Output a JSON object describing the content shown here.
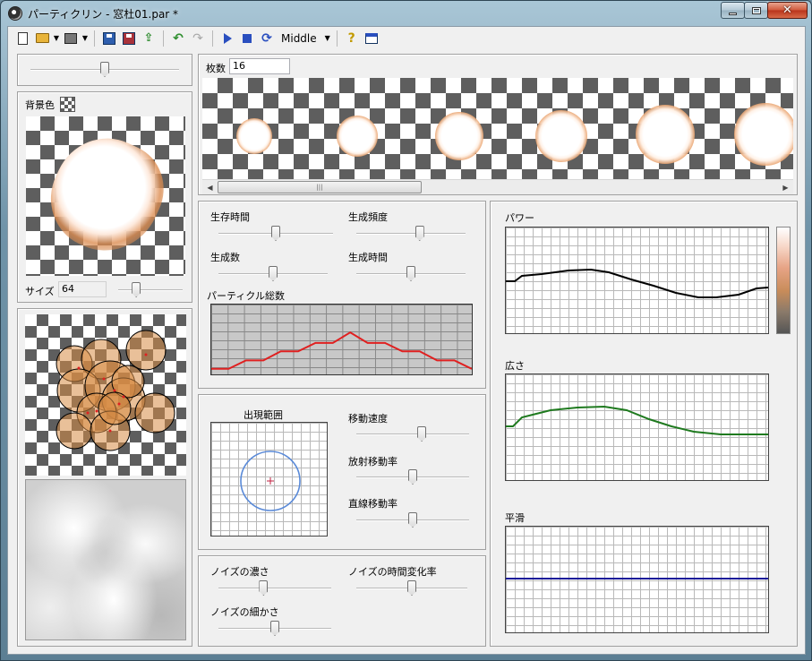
{
  "window": {
    "title": "パーティクリン - 窓杜01.par *",
    "min_label": "minimize",
    "max_label": "maximize",
    "close_label": "close"
  },
  "toolbar": {
    "speed_label": "Middle",
    "buttons": [
      "new-icon",
      "open-folder-icon",
      "export-icon",
      "save-icon",
      "save-as-icon",
      "upload-icon",
      "undo-icon",
      "redo-icon",
      "play-icon",
      "stop-icon",
      "loop-icon",
      "help-icon",
      "window-icon"
    ]
  },
  "left": {
    "top_slider_value": 0.5,
    "bg_color_label": "背景色",
    "size_label": "サイズ",
    "size_value": "64",
    "size_slider_value": 0.28
  },
  "frames": {
    "count_label": "枚数",
    "count_value": "16"
  },
  "emission": {
    "lifetime_label": "生存時間",
    "frequency_label": "生成頻度",
    "count_label": "生成数",
    "duration_label": "生成時間",
    "total_label": "パーティクル総数",
    "sliders": {
      "lifetime": 0.5,
      "frequency": 0.58,
      "count": 0.5,
      "duration": 0.5
    },
    "total_chart": [
      0.08,
      0.08,
      0.2,
      0.2,
      0.33,
      0.33,
      0.45,
      0.45,
      0.6,
      0.45,
      0.45,
      0.33,
      0.33,
      0.2,
      0.2,
      0.08
    ]
  },
  "motion": {
    "range_label": "出現範囲",
    "speed_label": "移動速度",
    "radial_label": "放射移動率",
    "linear_label": "直線移動率",
    "sliders": {
      "speed": 0.58,
      "radial": 0.5,
      "linear": 0.5
    }
  },
  "noise": {
    "density_label": "ノイズの濃さ",
    "time_rate_label": "ノイズの時間変化率",
    "fineness_label": "ノイズの細かさ",
    "sliders": {
      "density": 0.4,
      "time_rate": 0.5,
      "fineness": 0.5
    }
  },
  "curves": {
    "power_label": "パワー",
    "spread_label": "広さ",
    "smooth_label": "平滑",
    "power_color": "#000000",
    "spread_color": "#1f7a1f",
    "smooth_color": "#1a1a9a"
  },
  "colors": {
    "accent_red": "#e02020",
    "circle_blue": "#5a8ad8"
  }
}
